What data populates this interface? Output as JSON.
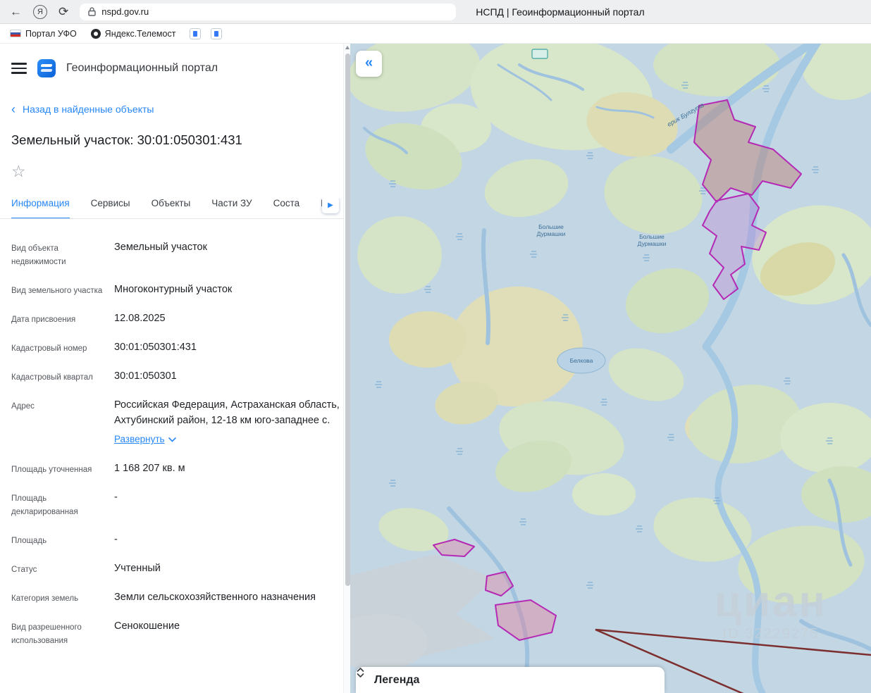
{
  "browser": {
    "url": "nspd.gov.ru",
    "page_title": "НСПД | Геоинформационный портал",
    "bookmarks": [
      {
        "label": "Портал УФО"
      },
      {
        "label": "Яндекс.Телемост"
      }
    ]
  },
  "icons": {
    "back_arrow": "←",
    "reload": "⟳",
    "browser_logo": "Я",
    "back_chevron": "‹",
    "star": "☆",
    "tab_more": "▶",
    "map_collapse": "«"
  },
  "panel": {
    "app_title": "Геоинформационный портал",
    "back_link": "Назад в найденные объекты",
    "object_title": "Земельный участок: 30:01:050301:431",
    "tabs": [
      {
        "label": "Информация",
        "active": true
      },
      {
        "label": "Сервисы",
        "active": false
      },
      {
        "label": "Объекты",
        "active": false
      },
      {
        "label": "Части ЗУ",
        "active": false
      },
      {
        "label": "Соста",
        "active": false
      },
      {
        "label": "Г",
        "active": false
      }
    ],
    "address_expand": "Развернуть",
    "fields": [
      {
        "label": "Вид объекта недвижимости",
        "value": "Земельный участок"
      },
      {
        "label": "Вид земельного участка",
        "value": "Многоконтурный участок"
      },
      {
        "label": "Дата присвоения",
        "value": "12.08.2025"
      },
      {
        "label": "Кадастровый номер",
        "value": "30:01:050301:431"
      },
      {
        "label": "Кадастровый квартал",
        "value": "30:01:050301"
      },
      {
        "label": "Адрес",
        "value": "Российская Федерация, Астраханская область, Ахтубинский район, 12-18 км юго-западнее с."
      },
      {
        "label": "Площадь уточненная",
        "value": "1 168 207 кв. м"
      },
      {
        "label": "Площадь декларированная",
        "value": "-"
      },
      {
        "label": "Площадь",
        "value": "-"
      },
      {
        "label": "Статус",
        "value": "Учтенный"
      },
      {
        "label": "Категория земель",
        "value": "Земли сельскохозяйственного назначения"
      },
      {
        "label": "Вид разрешенного использования",
        "value": "Сенокошение"
      }
    ]
  },
  "map": {
    "legend_title": "Легенда",
    "watermark": {
      "text": "циан",
      "id": "ID 32229275"
    },
    "labels": {
      "place1_line1": "Большие",
      "place1_line2": "Дурмашки",
      "place2_line1": "Большие",
      "place2_line2": "Дурмашки",
      "lake": "Белкова",
      "river": "ерик Булгута"
    },
    "colors": {
      "parcel_outline": "#b52ab5",
      "boundary_line": "#7c2f2f",
      "accent": "#2787f5"
    }
  }
}
